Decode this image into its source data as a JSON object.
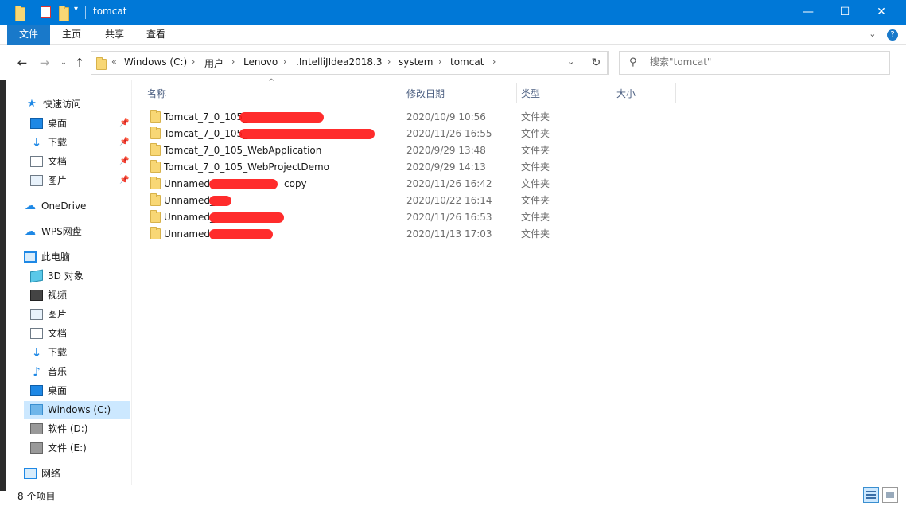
{
  "window": {
    "title": "tomcat",
    "minimize_glyph": "—",
    "maximize_glyph": "☐",
    "close_glyph": "✕"
  },
  "ribbon": {
    "tabs": [
      "文件",
      "主页",
      "共享",
      "查看"
    ],
    "expand_glyph": "⌄",
    "help_glyph": "?"
  },
  "address": {
    "overflow": "«",
    "crumbs": [
      "Windows (C:)",
      "用户",
      "Lenovo",
      ".IntelliJIdea2018.3",
      "system",
      "tomcat"
    ],
    "separator": "›"
  },
  "search": {
    "placeholder": "搜索\"tomcat\""
  },
  "nav": {
    "quick_access": "快速访问",
    "quick_items": [
      {
        "label": "桌面",
        "icon": "desktop-icon"
      },
      {
        "label": "下载",
        "icon": "download-icon"
      },
      {
        "label": "文档",
        "icon": "document-icon"
      },
      {
        "label": "图片",
        "icon": "pictures-icon"
      }
    ],
    "onedrive": "OneDrive",
    "wps": "WPS网盘",
    "this_pc": "此电脑",
    "pc_items": [
      {
        "label": "3D 对象",
        "icon": "3d-objects-icon"
      },
      {
        "label": "视频",
        "icon": "video-icon"
      },
      {
        "label": "图片",
        "icon": "pictures-icon"
      },
      {
        "label": "文档",
        "icon": "document-icon"
      },
      {
        "label": "下载",
        "icon": "download-icon"
      },
      {
        "label": "音乐",
        "icon": "music-icon"
      },
      {
        "label": "桌面",
        "icon": "desktop-icon"
      },
      {
        "label": "Windows (C:)",
        "icon": "windows-drive-icon"
      },
      {
        "label": "软件 (D:)",
        "icon": "drive-icon"
      },
      {
        "label": "文件 (E:)",
        "icon": "drive-icon"
      }
    ],
    "network": "网络"
  },
  "columns": {
    "name": "名称",
    "date": "修改日期",
    "type": "类型",
    "size": "大小"
  },
  "files": [
    {
      "name": "Tomcat_7_0_105_",
      "date": "2020/10/9 10:56",
      "type": "文件夹"
    },
    {
      "name": "Tomcat_7_0_105_",
      "date": "2020/11/26 16:55",
      "type": "文件夹"
    },
    {
      "name": "Tomcat_7_0_105_WebApplication",
      "date": "2020/9/29 13:48",
      "type": "文件夹"
    },
    {
      "name": "Tomcat_7_0_105_WebProjectDemo",
      "date": "2020/9/29 14:13",
      "type": "文件夹"
    },
    {
      "name": "Unnamed_",
      "suffix": "_copy",
      "date": "2020/11/26 16:42",
      "type": "文件夹"
    },
    {
      "name": "Unnamed_",
      "date": "2020/10/22 16:14",
      "type": "文件夹"
    },
    {
      "name": "Unnamed_",
      "date": "2020/11/26 16:53",
      "type": "文件夹"
    },
    {
      "name": "Unnamed_",
      "date": "2020/11/13 17:03",
      "type": "文件夹"
    }
  ],
  "status": {
    "item_count": "8 个项目"
  },
  "colors": {
    "titlebar": "#0078d7",
    "file_tab": "#1979ca",
    "selection": "#cce8ff",
    "folder": "#f8d775",
    "redaction": "#ff1a1a"
  }
}
